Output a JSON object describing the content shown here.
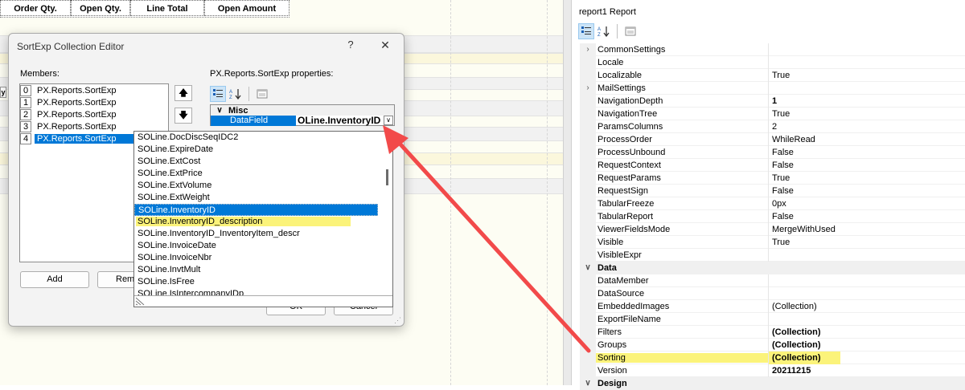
{
  "designer": {
    "header_cells": [
      "Order Qty.",
      "Open Qty.",
      "Line Total",
      "Open Amount"
    ],
    "side_marker": "y"
  },
  "properties_panel": {
    "title": "report1 Report",
    "toolbar_icons": [
      "categorized-icon",
      "alphabetical-icon",
      "property-pages-icon"
    ],
    "rows": [
      {
        "type": "prop",
        "name": "CommonSettings",
        "value": "",
        "expand": true
      },
      {
        "type": "prop",
        "name": "Locale",
        "value": ""
      },
      {
        "type": "prop",
        "name": "Localizable",
        "value": "True"
      },
      {
        "type": "prop",
        "name": "MailSettings",
        "value": "",
        "expand": true
      },
      {
        "type": "prop",
        "name": "NavigationDepth",
        "value": "1",
        "bold": true
      },
      {
        "type": "prop",
        "name": "NavigationTree",
        "value": "True"
      },
      {
        "type": "prop",
        "name": "ParamsColumns",
        "value": "2"
      },
      {
        "type": "prop",
        "name": "ProcessOrder",
        "value": "WhileRead"
      },
      {
        "type": "prop",
        "name": "ProcessUnbound",
        "value": "False"
      },
      {
        "type": "prop",
        "name": "RequestContext",
        "value": "False"
      },
      {
        "type": "prop",
        "name": "RequestParams",
        "value": "True"
      },
      {
        "type": "prop",
        "name": "RequestSign",
        "value": "False"
      },
      {
        "type": "prop",
        "name": "TabularFreeze",
        "value": "0px"
      },
      {
        "type": "prop",
        "name": "TabularReport",
        "value": "False"
      },
      {
        "type": "prop",
        "name": "ViewerFieldsMode",
        "value": "MergeWithUsed"
      },
      {
        "type": "prop",
        "name": "Visible",
        "value": "True"
      },
      {
        "type": "prop",
        "name": "VisibleExpr",
        "value": ""
      },
      {
        "type": "cat",
        "name": "Data",
        "value": ""
      },
      {
        "type": "prop",
        "name": "DataMember",
        "value": ""
      },
      {
        "type": "prop",
        "name": "DataSource",
        "value": ""
      },
      {
        "type": "prop",
        "name": "EmbeddedImages",
        "value": "(Collection)"
      },
      {
        "type": "prop",
        "name": "ExportFileName",
        "value": ""
      },
      {
        "type": "prop",
        "name": "Filters",
        "value": "(Collection)",
        "bold": true
      },
      {
        "type": "prop",
        "name": "Groups",
        "value": "(Collection)",
        "bold": true
      },
      {
        "type": "prop",
        "name": "Sorting",
        "value": "(Collection)",
        "bold": true,
        "highlight": true
      },
      {
        "type": "prop",
        "name": "Version",
        "value": "20211215",
        "bold": true
      },
      {
        "type": "cat",
        "name": "Design",
        "value": ""
      }
    ]
  },
  "dialog": {
    "title": "SortExp Collection Editor",
    "help_glyph": "?",
    "close_glyph": "✕",
    "members_label": "Members:",
    "properties_label": "PX.Reports.SortExp properties:",
    "members": [
      {
        "index": "0",
        "label": "PX.Reports.SortExp"
      },
      {
        "index": "1",
        "label": "PX.Reports.SortExp"
      },
      {
        "index": "2",
        "label": "PX.Reports.SortExp"
      },
      {
        "index": "3",
        "label": "PX.Reports.SortExp"
      },
      {
        "index": "4",
        "label": "PX.Reports.SortExp",
        "selected": true
      }
    ],
    "move_up_glyph": "🡅",
    "move_down_glyph": "🡇",
    "grid_category": "Misc",
    "grid_property": "DataField",
    "grid_value": "OLine.InventoryID",
    "add_button": "Add",
    "remove_button": "Remo",
    "ok_button": "OK",
    "cancel_button": "Cancel"
  },
  "dropdown": {
    "items": [
      {
        "label": "SOLine.DocDiscSeqIDC2"
      },
      {
        "label": "SOLine.ExpireDate"
      },
      {
        "label": "SOLine.ExtCost"
      },
      {
        "label": "SOLine.ExtPrice"
      },
      {
        "label": "SOLine.ExtVolume"
      },
      {
        "label": "SOLine.ExtWeight"
      },
      {
        "label": "SOLine.InventoryID",
        "selected": true
      },
      {
        "label": "SOLine.InventoryID_description",
        "highlight": true
      },
      {
        "label": "SOLine.InventoryID_InventoryItem_descr"
      },
      {
        "label": "SOLine.InvoiceDate"
      },
      {
        "label": "SOLine.InvoiceNbr"
      },
      {
        "label": "SOLine.InvtMult"
      },
      {
        "label": "SOLine.IsFree"
      },
      {
        "label": "SOLine.IsIntercompanyIDp"
      }
    ]
  },
  "colors": {
    "highlight": "#fbf37a",
    "selection": "#0078d7",
    "annotation_arrow": "#f24a4a"
  }
}
